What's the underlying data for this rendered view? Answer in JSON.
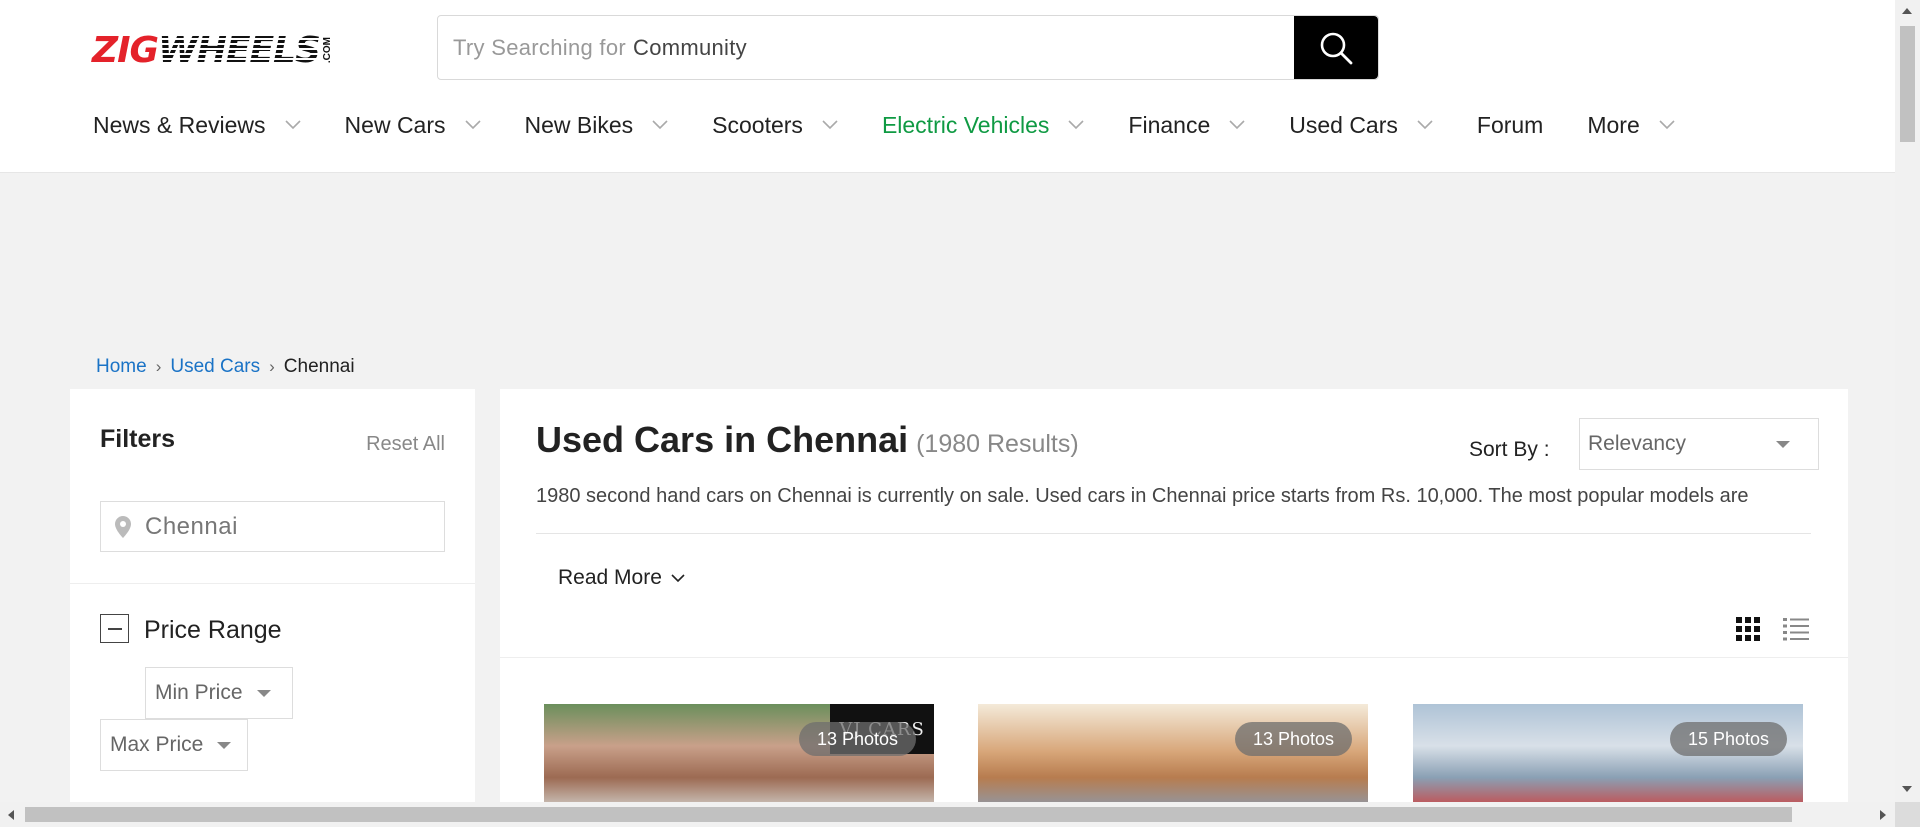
{
  "header": {
    "logo": {
      "brand": "ZIGWHEELS",
      "suffix": ".COM"
    },
    "search": {
      "placeholder": "Try Searching for",
      "keyword": "Community"
    },
    "nav": [
      {
        "label": "News & Reviews",
        "has_dropdown": true
      },
      {
        "label": "New Cars",
        "has_dropdown": true
      },
      {
        "label": "New Bikes",
        "has_dropdown": true
      },
      {
        "label": "Scooters",
        "has_dropdown": true
      },
      {
        "label": "Electric Vehicles",
        "has_dropdown": true,
        "color": "#0f9a43"
      },
      {
        "label": "Finance",
        "has_dropdown": true
      },
      {
        "label": "Used Cars",
        "has_dropdown": true
      },
      {
        "label": "Forum",
        "has_dropdown": false
      },
      {
        "label": "More",
        "has_dropdown": true
      }
    ]
  },
  "breadcrumb": [
    {
      "label": "Home",
      "link": true
    },
    {
      "label": "Used Cars",
      "link": true
    },
    {
      "label": "Chennai",
      "link": false
    }
  ],
  "filters": {
    "title": "Filters",
    "reset_label": "Reset All",
    "location_value": "Chennai",
    "price_range": {
      "label": "Price Range",
      "min_label": "Min Price",
      "max_label": "Max Price"
    }
  },
  "main": {
    "title": "Used Cars in Chennai",
    "results_count": "(1980 Results)",
    "sort_label": "Sort By :",
    "sort_value": "Relevancy",
    "description": "1980 second hand cars on Chennai is currently on sale. Used cars in Chennai price starts from Rs. 10,000. The most popular models are",
    "read_more_label": "Read More",
    "listings": [
      {
        "photos_label": "13 Photos",
        "dealer_badge": "VJ CARS"
      },
      {
        "photos_label": "13 Photos"
      },
      {
        "photos_label": "15 Photos"
      }
    ]
  },
  "colors": {
    "brand_red": "#e4222a",
    "link_blue": "#1a73c6",
    "ev_green": "#0f9a43",
    "search_button": "#000000"
  },
  "icons": [
    "search-icon",
    "chevron-down-icon",
    "location-pin-icon",
    "minus-icon",
    "grid-view-icon",
    "list-view-icon"
  ]
}
